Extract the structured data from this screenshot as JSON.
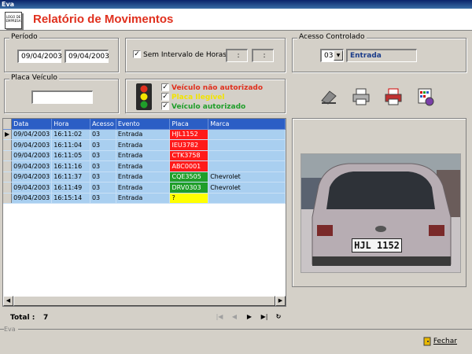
{
  "window": {
    "title": "Eva"
  },
  "header": {
    "title": "Relatório de Movimentos",
    "icon_text": "LOGO DE EMPRESA"
  },
  "periodo": {
    "label": "Período",
    "date_from": "09/04/2003",
    "date_to": "09/04/2003"
  },
  "horas": {
    "checkbox_label": "Sem Intervalo de Horas",
    "checked": true,
    "time_from": ":",
    "time_to": ":"
  },
  "acesso": {
    "label": "Acesso Controlado",
    "selected": "03",
    "name": "Entrada"
  },
  "placa": {
    "label": "Placa Veículo",
    "value": ""
  },
  "legend": {
    "items": [
      {
        "label": "Veículo não autorizado",
        "color": "#e0301e"
      },
      {
        "label": "Placa Ilegível",
        "color": "#f2e400"
      },
      {
        "label": "Veículo autorizado",
        "color": "#1f9e2a"
      }
    ]
  },
  "grid": {
    "columns": [
      "Data",
      "Hora",
      "Acesso",
      "Evento",
      "Placa",
      "Marca"
    ],
    "rows": [
      {
        "data": "09/04/2003",
        "hora": "16:11:02",
        "acesso": "03",
        "evento": "Entrada",
        "placa": "HJL1152",
        "status": "red",
        "marca": ""
      },
      {
        "data": "09/04/2003",
        "hora": "16:11:04",
        "acesso": "03",
        "evento": "Entrada",
        "placa": "IEU3782",
        "status": "red",
        "marca": ""
      },
      {
        "data": "09/04/2003",
        "hora": "16:11:05",
        "acesso": "03",
        "evento": "Entrada",
        "placa": "CTK3758",
        "status": "red",
        "marca": ""
      },
      {
        "data": "09/04/2003",
        "hora": "16:11:16",
        "acesso": "03",
        "evento": "Entrada",
        "placa": "ABC0001",
        "status": "red",
        "marca": ""
      },
      {
        "data": "09/04/2003",
        "hora": "16:11:37",
        "acesso": "03",
        "evento": "Entrada",
        "placa": "CQE3505",
        "status": "green",
        "marca": "Chevrolet"
      },
      {
        "data": "09/04/2003",
        "hora": "16:11:49",
        "acesso": "03",
        "evento": "Entrada",
        "placa": "DRV0303",
        "status": "green",
        "marca": "Chevrolet"
      },
      {
        "data": "09/04/2003",
        "hora": "16:15:14",
        "acesso": "03",
        "evento": "Entrada",
        "placa": "?",
        "status": "yellow",
        "marca": ""
      }
    ]
  },
  "photo": {
    "plate": "HJL 1152"
  },
  "status": {
    "total_label": "Total :",
    "total_value": "7"
  },
  "footer": {
    "label": "Eva",
    "close_label": "Fechar"
  }
}
